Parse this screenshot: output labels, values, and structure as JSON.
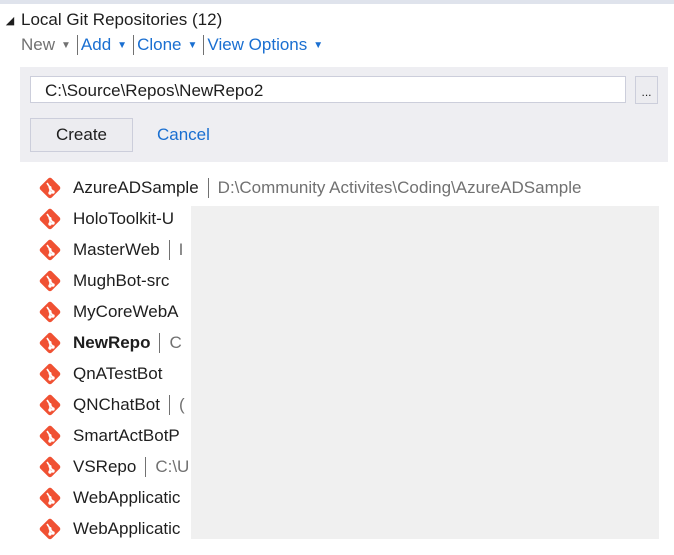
{
  "section": {
    "expander_glyph": "◢",
    "title": "Local Git Repositories (12)"
  },
  "toolbar": {
    "new_label": "New",
    "add_label": "Add",
    "clone_label": "Clone",
    "view_options_label": "View Options",
    "caret_glyph": "▼"
  },
  "create_panel": {
    "path_value": "C:\\Source\\Repos\\NewRepo2",
    "browse_label": "...",
    "create_label": "Create",
    "cancel_label": "Cancel"
  },
  "colors": {
    "git_icon": "#f05133",
    "link": "#1a6fd1",
    "muted": "#717171"
  },
  "repositories": [
    {
      "name": "AzureADSample",
      "path": "D:\\Community Activites\\Coding\\AzureADSample",
      "icon": "git-repo-icon"
    },
    {
      "name": "HoloToolkit-U",
      "path": "",
      "icon": "git-repo-icon"
    },
    {
      "name": "MasterWeb",
      "path": "I",
      "icon": "git-repo-icon"
    },
    {
      "name": "MughBot-src",
      "path": "",
      "icon": "git-repo-icon"
    },
    {
      "name": "MyCoreWebA",
      "path": "",
      "icon": "git-repo-icon"
    },
    {
      "name": "NewRepo",
      "path": "C",
      "icon": "git-repo-icon",
      "active": true
    },
    {
      "name": "QnATestBot",
      "path": "",
      "icon": "git-repo-icon"
    },
    {
      "name": "QNChatBot",
      "path": "(",
      "icon": "git-repo-icon"
    },
    {
      "name": "SmartActBotP",
      "path": "",
      "icon": "git-repo-icon"
    },
    {
      "name": "VSRepo",
      "path": "C:\\U",
      "icon": "git-repo-icon"
    },
    {
      "name": "WebApplicatic",
      "path": "",
      "icon": "git-repo-icon"
    },
    {
      "name": "WebApplicatic",
      "path": "",
      "icon": "git-repo-icon"
    }
  ]
}
